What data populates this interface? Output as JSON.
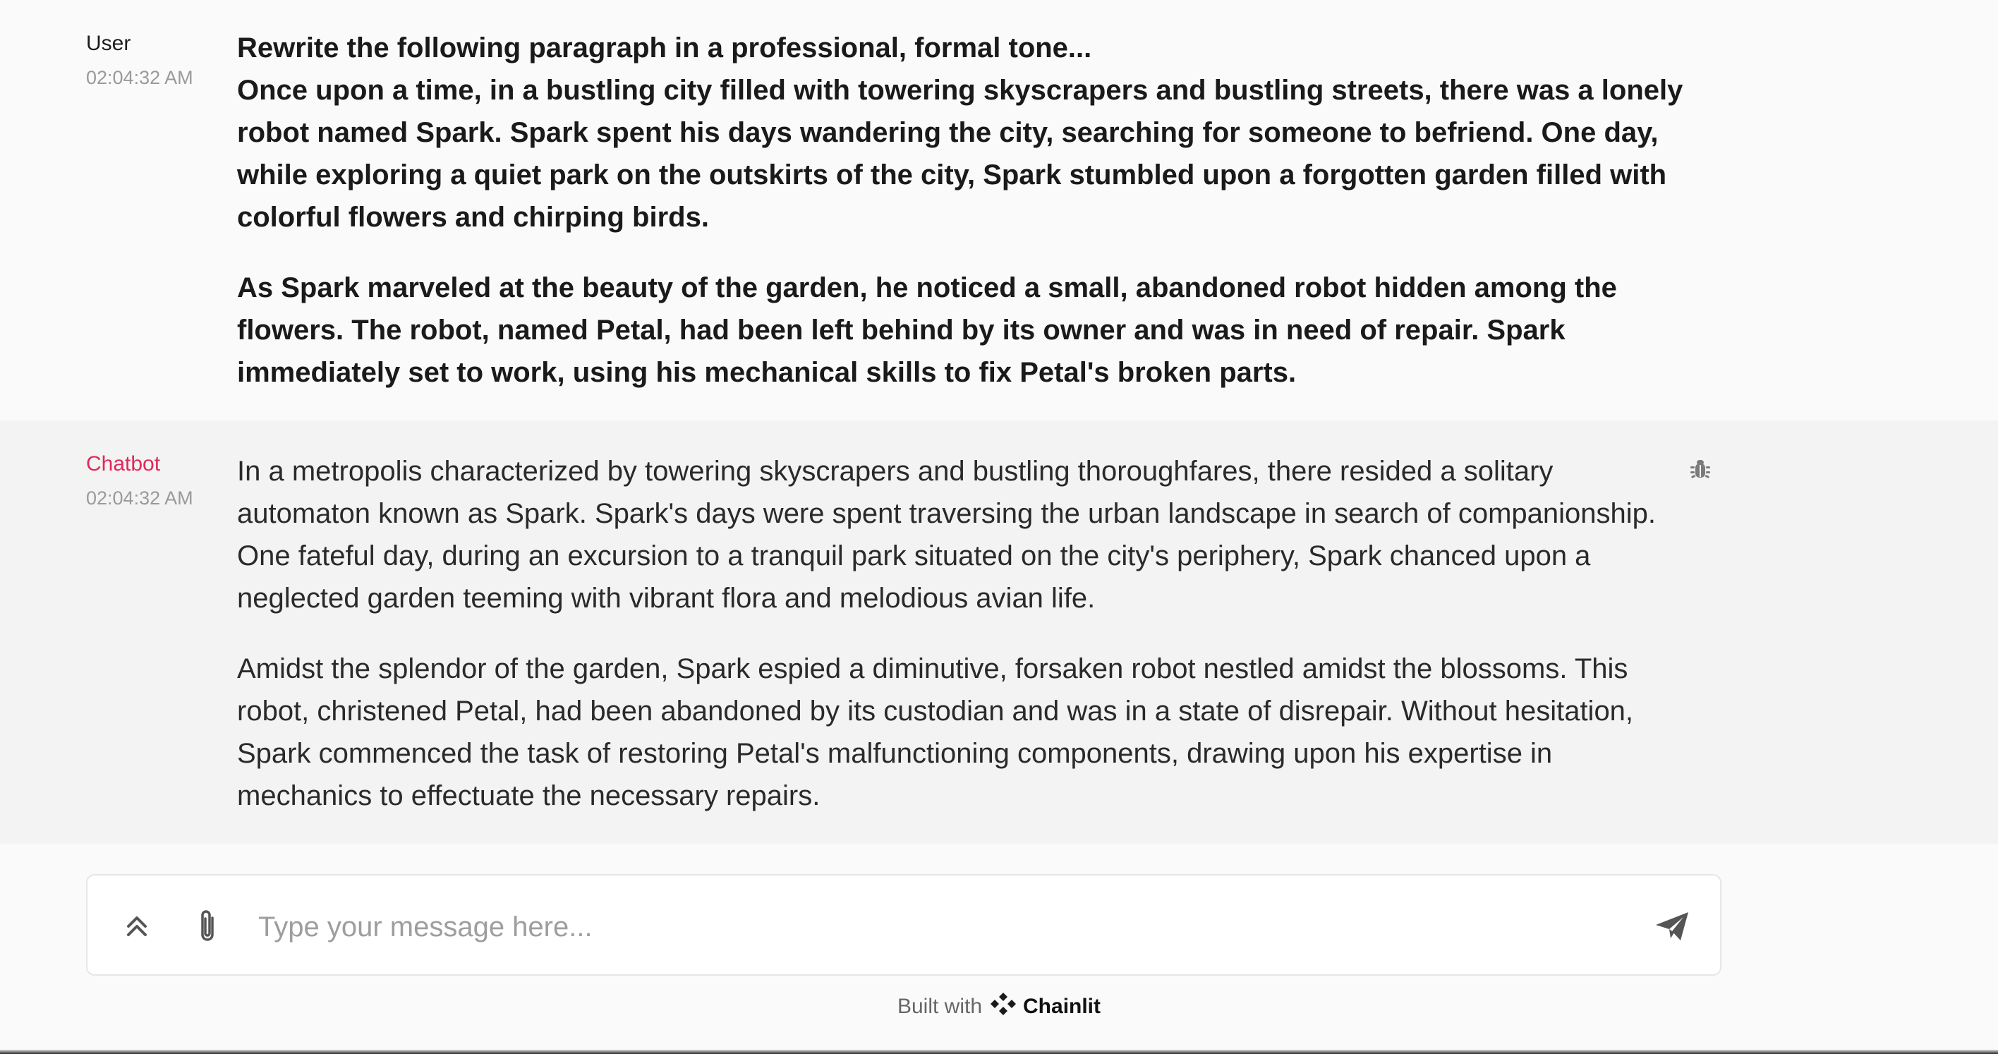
{
  "messages": [
    {
      "author": "User",
      "timestamp": "02:04:32 AM",
      "paragraphs": [
        "Rewrite the following paragraph in a professional, formal tone...",
        "Once upon a time, in a bustling city filled with towering skyscrapers and bustling streets, there was a lonely robot named Spark. Spark spent his days wandering the city, searching for someone to befriend. One day, while exploring a quiet park on the outskirts of the city, Spark stumbled upon a forgotten garden filled with colorful flowers and chirping birds.",
        "As Spark marveled at the beauty of the garden, he noticed a small, abandoned robot hidden among the flowers. The robot, named Petal, had been left behind by its owner and was in need of repair. Spark immediately set to work, using his mechanical skills to fix Petal's broken parts."
      ]
    },
    {
      "author": "Chatbot",
      "timestamp": "02:04:32 AM",
      "author_color": "#e0295a",
      "paragraphs": [
        "In a metropolis characterized by towering skyscrapers and bustling thoroughfares, there resided a solitary automaton known as Spark. Spark's days were spent traversing the urban landscape in search of companionship. One fateful day, during an excursion to a tranquil park situated on the city's periphery, Spark chanced upon a neglected garden teeming with vibrant flora and melodious avian life.",
        "Amidst the splendor of the garden, Spark espied a diminutive, forsaken robot nestled amidst the blossoms. This robot, christened Petal, had been abandoned by its custodian and was in a state of disrepair. Without hesitation, Spark commenced the task of restoring Petal's malfunctioning components, drawing upon his expertise in mechanics to effectuate the necessary repairs."
      ],
      "icon": "bug-icon"
    }
  ],
  "composer": {
    "placeholder": "Type your message here...",
    "value": "",
    "settings_icon": "chevrons-up-icon",
    "attach_icon": "paperclip-icon",
    "send_icon": "send-icon"
  },
  "footer": {
    "prefix": "Built with",
    "brand": "Chainlit",
    "brand_icon": "chainlit-logo-icon"
  },
  "colors": {
    "accent": "#e0295a",
    "user_bg": "#fafafa",
    "bot_bg": "#f3f3f3"
  }
}
